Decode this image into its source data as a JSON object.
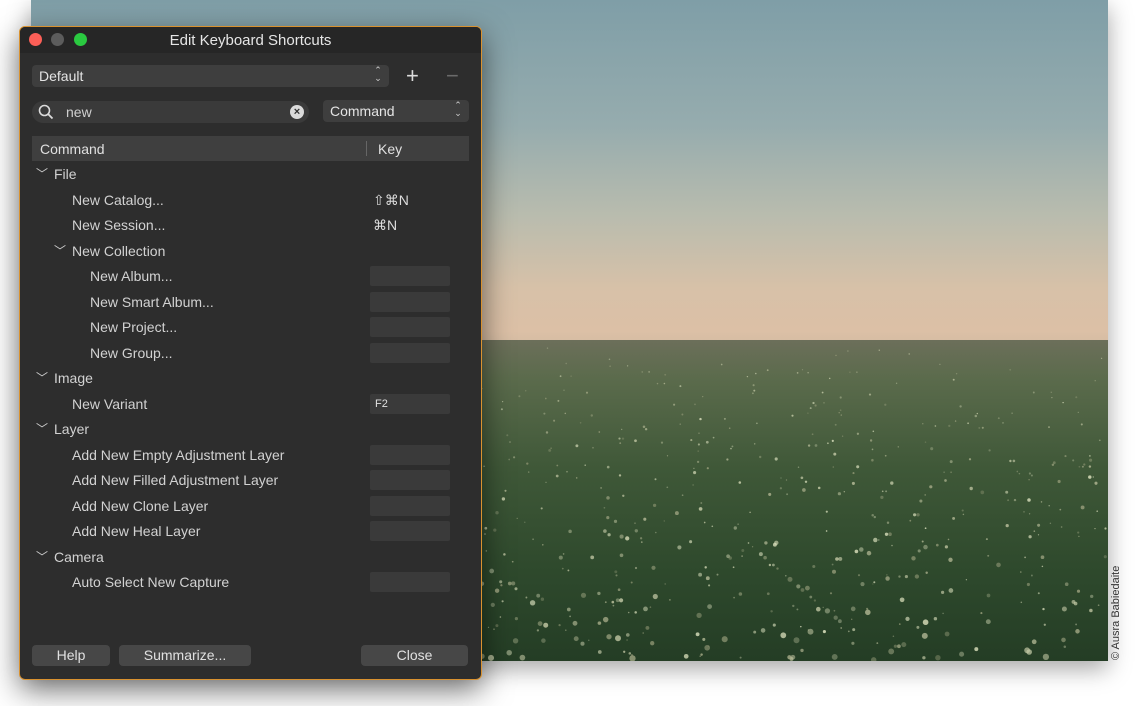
{
  "photo_credit": "© Ausra Babiedaite",
  "dialog": {
    "title": "Edit Keyboard Shortcuts",
    "preset": {
      "value": "Default"
    },
    "add_label": "+",
    "remove_label": "−",
    "search": {
      "value": "new"
    },
    "scope": {
      "value": "Command"
    },
    "table": {
      "columns": {
        "command": "Command",
        "key": "Key"
      },
      "rows": [
        {
          "label": "File"
        },
        {
          "label": "New Catalog...",
          "key": "⇧⌘N"
        },
        {
          "label": "New Session...",
          "key": "⌘N"
        },
        {
          "label": "New Collection"
        },
        {
          "label": "New Album..."
        },
        {
          "label": "New Smart Album..."
        },
        {
          "label": "New Project..."
        },
        {
          "label": "New Group..."
        },
        {
          "label": "Image"
        },
        {
          "label": "New Variant",
          "key": "F2"
        },
        {
          "label": "Layer"
        },
        {
          "label": "Add New Empty Adjustment Layer"
        },
        {
          "label": "Add New Filled Adjustment Layer"
        },
        {
          "label": "Add New Clone Layer"
        },
        {
          "label": "Add New Heal Layer"
        },
        {
          "label": "Camera"
        },
        {
          "label": "Auto Select New Capture"
        }
      ]
    },
    "buttons": {
      "help": "Help",
      "summarize": "Summarize...",
      "close": "Close"
    }
  },
  "colors": {
    "dialog_bg": "#2d2d2d",
    "focus_border": "#d99230",
    "close_light": "#fc5f57",
    "zoom_light": "#2ac940"
  }
}
